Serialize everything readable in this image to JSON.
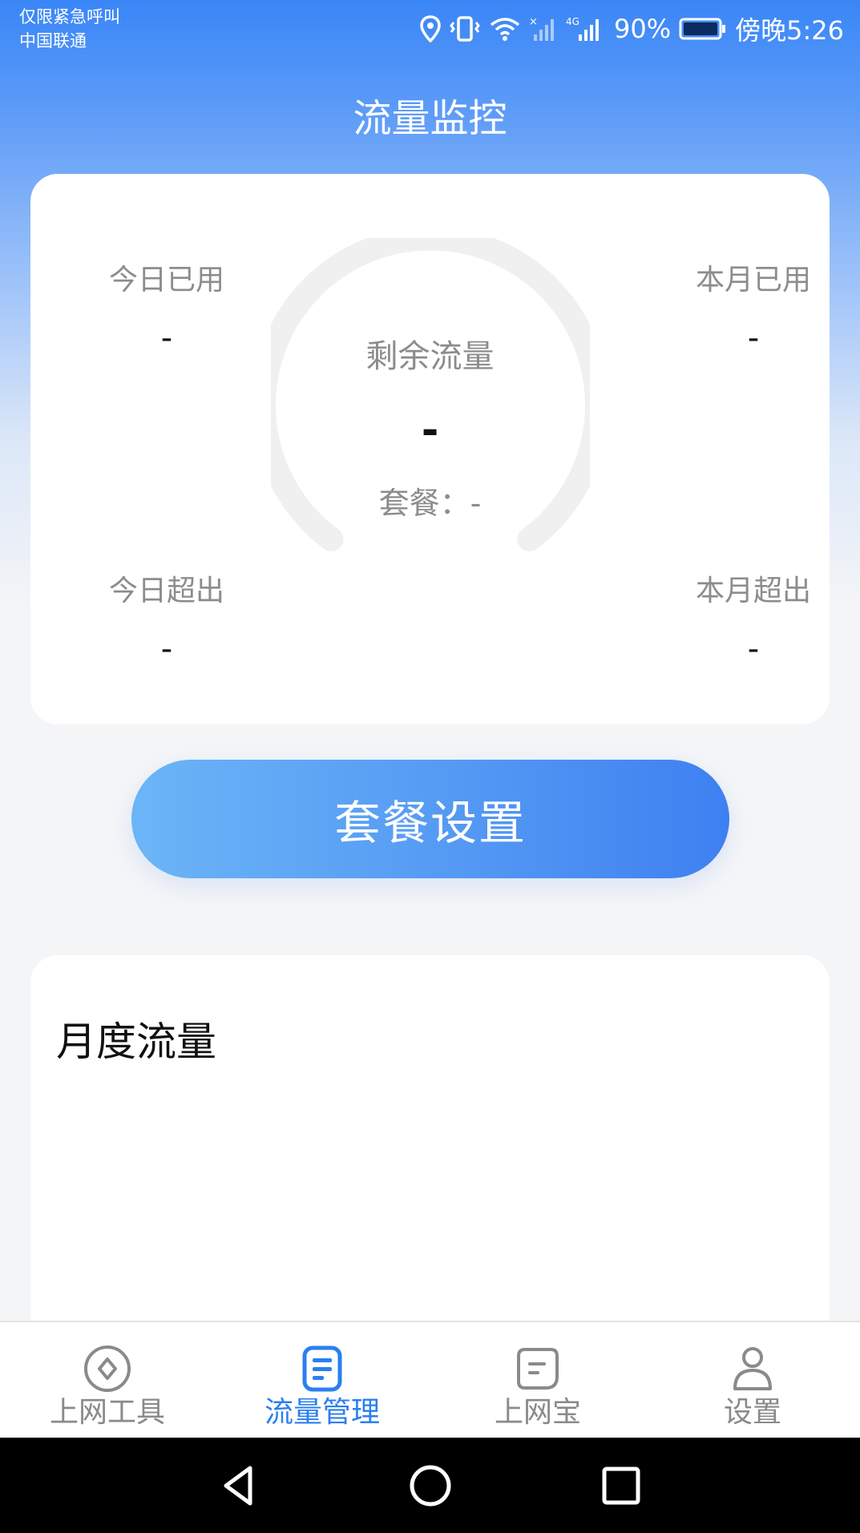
{
  "status_bar": {
    "emergency_text": "仅限紧急呼叫",
    "carrier": "中国联通",
    "network_label": "4G",
    "battery_percent": "90%",
    "time": "傍晚5:26"
  },
  "header": {
    "title": "流量监控"
  },
  "usage_card": {
    "today_used_label": "今日已用",
    "today_used_value": "-",
    "month_used_label": "本月已用",
    "month_used_value": "-",
    "today_over_label": "今日超出",
    "today_over_value": "-",
    "month_over_label": "本月超出",
    "month_over_value": "-",
    "remaining_label": "剩余流量",
    "remaining_value": "-",
    "plan_text": "套餐：-"
  },
  "plan_button": {
    "label": "套餐设置"
  },
  "monthly": {
    "title": "月度流量"
  },
  "bottom_nav": {
    "items": [
      {
        "label": "上网工具",
        "icon": "compass-icon"
      },
      {
        "label": "流量管理",
        "icon": "document-icon",
        "active": true
      },
      {
        "label": "上网宝",
        "icon": "chat-note-icon"
      },
      {
        "label": "设置",
        "icon": "person-icon"
      }
    ]
  },
  "colors": {
    "accent": "#2b7ff0",
    "header_blue": "#3a86f7",
    "button_start": "#6bb5f7",
    "button_end": "#3e80f2"
  }
}
